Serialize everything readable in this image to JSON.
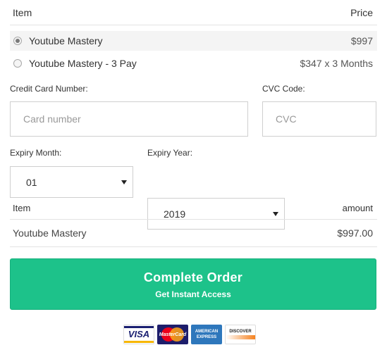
{
  "products_table": {
    "item_header": "Item",
    "price_header": "Price",
    "options": [
      {
        "label": "Youtube Mastery",
        "price": "$997",
        "selected": true
      },
      {
        "label": "Youtube Mastery - 3 Pay",
        "price": "$347 x 3 Months",
        "selected": false
      }
    ]
  },
  "payment": {
    "card_number_label": "Credit Card Number:",
    "card_number_placeholder": "Card number",
    "cvc_label": "CVC Code:",
    "cvc_placeholder": "CVC",
    "expiry_month_label": "Expiry Month:",
    "expiry_month_value": "01",
    "expiry_year_label": "Expiry Year:",
    "expiry_year_value": "2019"
  },
  "summary": {
    "item_header": "Item",
    "amount_header": "amount",
    "rows": [
      {
        "item": "Youtube Mastery",
        "amount": "$997.00"
      }
    ]
  },
  "cta": {
    "title": "Complete Order",
    "subtitle": "Get Instant Access",
    "color": "#1dc28a"
  },
  "card_logos": {
    "visa": "VISA",
    "mastercard": "MasterCard",
    "amex_line1": "AMERICAN",
    "amex_line2": "EXPRESS",
    "discover": "DISCOVER"
  }
}
